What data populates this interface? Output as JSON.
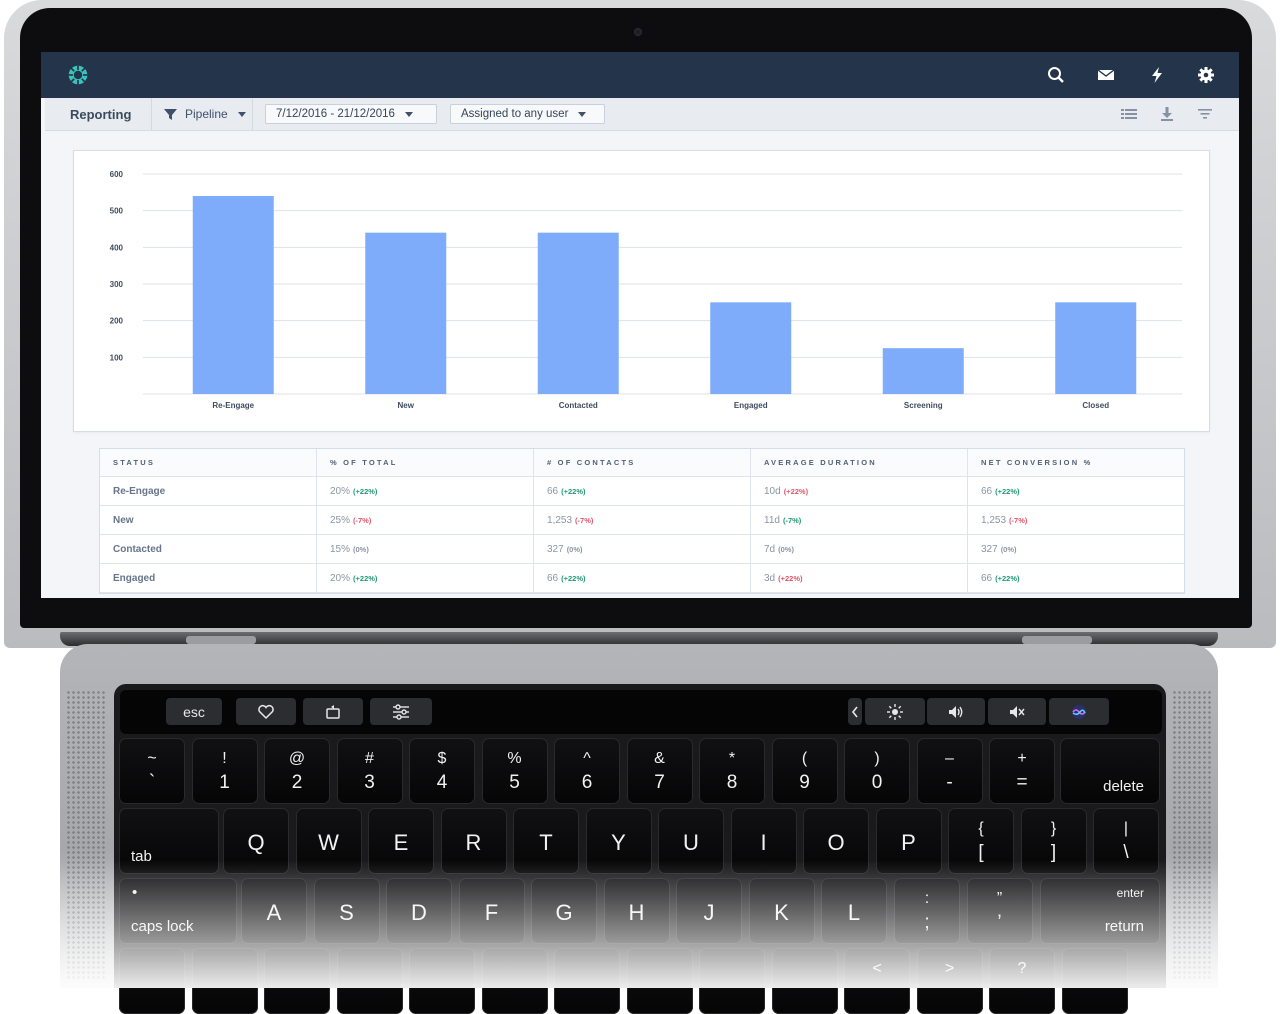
{
  "app": {
    "nav_icons": [
      "search-icon",
      "mail-icon",
      "bolt-icon",
      "gear-icon"
    ],
    "section_title": "Reporting",
    "pipeline_label": "Pipeline",
    "date_range": "7/12/2016 - 21/12/2016",
    "assignee_filter": "Assigned to any user",
    "toolbar_icons": [
      "list-view-icon",
      "download-icon",
      "filter-lines-icon"
    ]
  },
  "colors": {
    "nav_bg": "#24344a",
    "bar": "#7facfa",
    "positive": "#1e9a72",
    "negative": "#e0566a",
    "accent_logo": "#3cc1bb"
  },
  "chart_data": {
    "type": "bar",
    "categories": [
      "Re-Engage",
      "New",
      "Contacted",
      "Engaged",
      "Screening",
      "Closed"
    ],
    "values": [
      540,
      440,
      440,
      250,
      125,
      250
    ],
    "yticks": [
      100,
      200,
      300,
      400,
      500,
      600
    ],
    "ylim": [
      0,
      600
    ],
    "grid": true,
    "title": "",
    "xlabel": "",
    "ylabel": ""
  },
  "table": {
    "headers": [
      "STATUS",
      "% OF TOTAL",
      "# OF CONTACTS",
      "AVERAGE DURATION",
      "NET CONVERSION %"
    ],
    "rows": [
      {
        "status": "Re-Engage",
        "cells": [
          {
            "v": "20%",
            "c": "(+22%)",
            "t": "pos"
          },
          {
            "v": "66",
            "c": "(+22%)",
            "t": "pos"
          },
          {
            "v": "10d",
            "c": "(+22%)",
            "t": "neg"
          },
          {
            "v": "66",
            "c": "(+22%)",
            "t": "pos"
          }
        ]
      },
      {
        "status": "New",
        "cells": [
          {
            "v": "25%",
            "c": "(-7%)",
            "t": "neg"
          },
          {
            "v": "1,253",
            "c": "(-7%)",
            "t": "neg"
          },
          {
            "v": "11d",
            "c": "(-7%)",
            "t": "pos"
          },
          {
            "v": "1,253",
            "c": "(-7%)",
            "t": "neg"
          }
        ]
      },
      {
        "status": "Contacted",
        "cells": [
          {
            "v": "15%",
            "c": "(0%)",
            "t": "neu"
          },
          {
            "v": "327",
            "c": "(0%)",
            "t": "neu"
          },
          {
            "v": "7d",
            "c": "(0%)",
            "t": "neu"
          },
          {
            "v": "327",
            "c": "(0%)",
            "t": "neu"
          }
        ]
      },
      {
        "status": "Engaged",
        "cells": [
          {
            "v": "20%",
            "c": "(+22%)",
            "t": "pos"
          },
          {
            "v": "66",
            "c": "(+22%)",
            "t": "pos"
          },
          {
            "v": "3d",
            "c": "(+22%)",
            "t": "neg"
          },
          {
            "v": "66",
            "c": "(+22%)",
            "t": "pos"
          }
        ]
      }
    ]
  },
  "touchbar": {
    "esc": "esc"
  },
  "keyboard": {
    "row1": [
      [
        "~",
        "`"
      ],
      [
        "!",
        "1"
      ],
      [
        "@",
        "2"
      ],
      [
        "#",
        "3"
      ],
      [
        "$",
        "4"
      ],
      [
        "%",
        "5"
      ],
      [
        "^",
        "6"
      ],
      [
        "&",
        "7"
      ],
      [
        "*",
        "8"
      ],
      [
        "(",
        "9"
      ],
      [
        ")",
        "0"
      ],
      [
        "–",
        "-"
      ],
      [
        "+",
        "="
      ]
    ],
    "delete": "delete",
    "tab": "tab",
    "row2": [
      "Q",
      "W",
      "E",
      "R",
      "T",
      "Y",
      "U",
      "I",
      "O",
      "P"
    ],
    "row2_sym": [
      [
        "{",
        "["
      ],
      [
        "}",
        "]"
      ],
      [
        "|",
        "\\"
      ]
    ],
    "caps_dot": "•",
    "caps": "caps lock",
    "row3": [
      "A",
      "S",
      "D",
      "F",
      "G",
      "H",
      "J",
      "K",
      "L"
    ],
    "row3_sym": [
      [
        ":",
        ";"
      ],
      [
        "”",
        "’"
      ]
    ],
    "enter": "enter",
    "return": "return",
    "row4_partial": [
      "<",
      ">",
      "?"
    ]
  }
}
